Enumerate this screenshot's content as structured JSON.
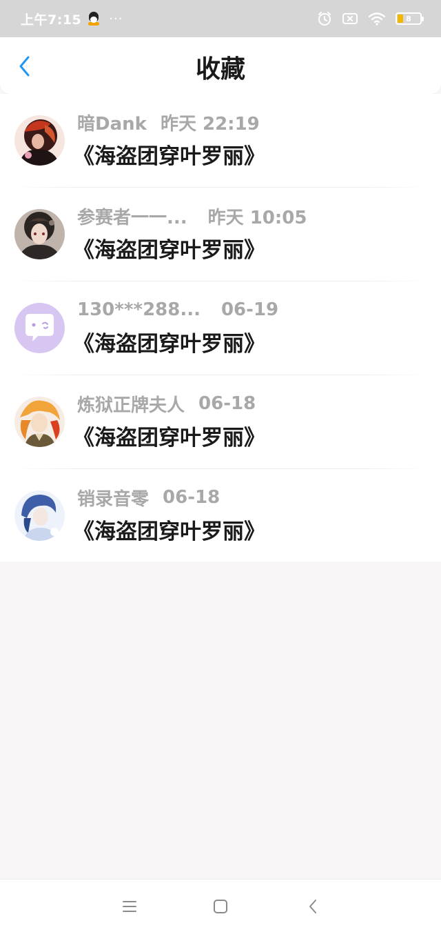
{
  "status_bar": {
    "time": "上午7:15",
    "dots": "···",
    "battery": "8",
    "icons": [
      "qq-icon",
      "alarm-icon",
      "sim-x-icon",
      "wifi-icon",
      "battery-icon"
    ]
  },
  "header": {
    "title": "收藏",
    "back_icon": "chevron-left-icon",
    "accent_color": "#2196f3"
  },
  "favorites": [
    {
      "user": "暗Dank",
      "time": "昨天 22:19",
      "title": "《海盗团穿叶罗丽》",
      "avatar": "avatar-anime-dark-red"
    },
    {
      "user": "参赛者一一...",
      "time": "昨天 10:05",
      "title": "《海盗团穿叶罗丽》",
      "avatar": "avatar-anime-gothic"
    },
    {
      "user": "130***288...",
      "time": "06-19",
      "title": "《海盗团穿叶罗丽》",
      "avatar": "avatar-default-chat"
    },
    {
      "user": "炼狱正牌夫人",
      "time": "06-18",
      "title": "《海盗团穿叶罗丽》",
      "avatar": "avatar-anime-flame"
    },
    {
      "user": "销录音零",
      "time": "06-18",
      "title": "《海盗团穿叶罗丽》",
      "avatar": "avatar-anime-blue"
    }
  ],
  "bottom_nav": {
    "icons": [
      "menu-icon",
      "home-square-icon",
      "back-arrow-icon"
    ]
  }
}
